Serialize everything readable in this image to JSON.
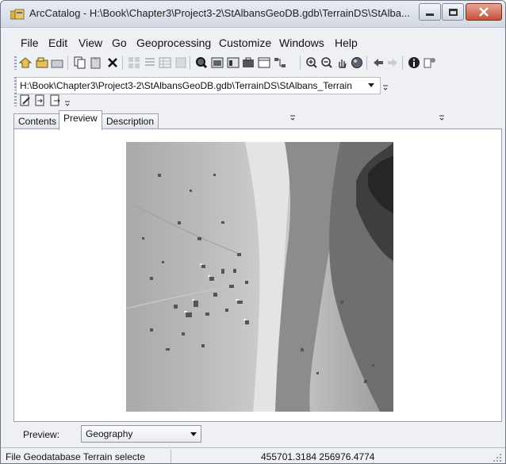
{
  "window": {
    "title": "ArcCatalog - H:\\Book\\Chapter3\\Project3-2\\StAlbansGeoDB.gdb\\TerrainDS\\StAlba..."
  },
  "menu": [
    "File",
    "Edit",
    "View",
    "Go",
    "Geoprocessing",
    "Customize",
    "Windows",
    "Help"
  ],
  "location": {
    "value": "H:\\Book\\Chapter3\\Project3-2\\StAlbansGeoDB.gdb\\TerrainDS\\StAlbans_Terrain"
  },
  "tabs": [
    {
      "label": "Contents",
      "active": false
    },
    {
      "label": "Preview",
      "active": true
    },
    {
      "label": "Description",
      "active": false
    }
  ],
  "preview": {
    "label": "Preview:",
    "selected": "Geography"
  },
  "status": {
    "text": "File Geodatabase Terrain selecte",
    "coordinates": "455701.3184  256976.4774"
  }
}
